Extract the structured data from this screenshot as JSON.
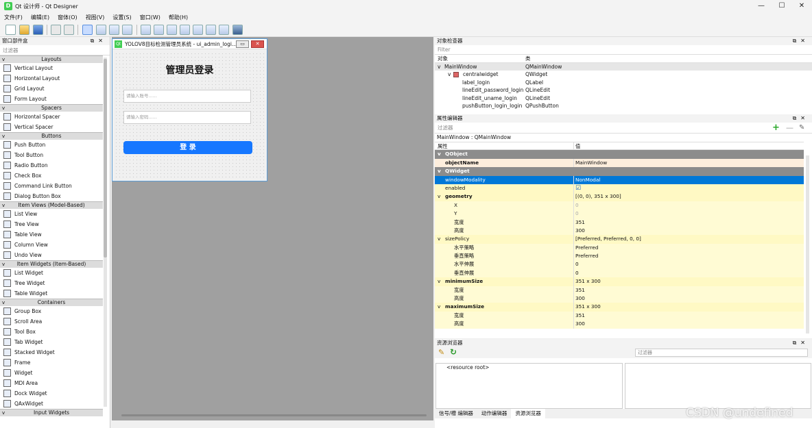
{
  "window": {
    "title": "Qt 设计师 - Qt Designer",
    "app_icon": "D",
    "minimize": "—",
    "maximize": "☐",
    "close": "✕"
  },
  "menu": [
    "文件(F)",
    "编辑(E)",
    "窗体(O)",
    "视图(V)",
    "设置(S)",
    "窗口(W)",
    "帮助(H)"
  ],
  "widget_box": {
    "title": "窗口部件盒",
    "filter_placeholder": "过滤器",
    "categories": [
      {
        "name": "Layouts",
        "items": [
          "Vertical Layout",
          "Horizontal Layout",
          "Grid Layout",
          "Form Layout"
        ]
      },
      {
        "name": "Spacers",
        "items": [
          "Horizontal Spacer",
          "Vertical Spacer"
        ]
      },
      {
        "name": "Buttons",
        "items": [
          "Push Button",
          "Tool Button",
          "Radio Button",
          "Check Box",
          "Command Link Button",
          "Dialog Button Box"
        ]
      },
      {
        "name": "Item Views (Model-Based)",
        "items": [
          "List View",
          "Tree View",
          "Table View",
          "Column View",
          "Undo View"
        ]
      },
      {
        "name": "Item Widgets (Item-Based)",
        "items": [
          "List Widget",
          "Tree Widget",
          "Table Widget"
        ]
      },
      {
        "name": "Containers",
        "items": [
          "Group Box",
          "Scroll Area",
          "Tool Box",
          "Tab Widget",
          "Stacked Widget",
          "Frame",
          "Widget",
          "MDI Area",
          "Dock Widget",
          "QAxWidget"
        ]
      },
      {
        "name": "Input Widgets",
        "items": []
      }
    ]
  },
  "form": {
    "window_title": "YOLOV8目标检测管理员系统 - ui_admin_logi...",
    "heading": "管理员登录",
    "username_placeholder": "请输入账号......",
    "password_placeholder": "请输入密码......",
    "login_button": "登 录"
  },
  "object_inspector": {
    "title": "对象检查器",
    "filter_placeholder": "Filter",
    "col_object": "对象",
    "col_class": "类",
    "rows": [
      {
        "name": "MainWindow",
        "class": "QMainWindow",
        "level": 0,
        "arrow": "v"
      },
      {
        "name": "centralwidget",
        "class": "QWidget",
        "level": 1,
        "arrow": "v"
      },
      {
        "name": "label_login",
        "class": "QLabel",
        "level": 2,
        "arrow": ""
      },
      {
        "name": "lineEdit_password_login",
        "class": "QLineEdit",
        "level": 2,
        "arrow": ""
      },
      {
        "name": "lineEdit_uname_login",
        "class": "QLineEdit",
        "level": 2,
        "arrow": ""
      },
      {
        "name": "pushButton_login_login",
        "class": "QPushButton",
        "level": 2,
        "arrow": ""
      }
    ]
  },
  "property_editor": {
    "title": "属性编辑器",
    "filter_placeholder": "过滤器",
    "context": "MainWindow : QMainWindow",
    "col_property": "属性",
    "col_value": "值",
    "rows": [
      {
        "k": "QObject",
        "v": "",
        "type": "grp"
      },
      {
        "k": "objectName",
        "v": "MainWindow",
        "type": "pk1",
        "bold": true
      },
      {
        "k": "QWidget",
        "v": "",
        "type": "grp"
      },
      {
        "k": "windowModality",
        "v": "NonModal",
        "type": "sel"
      },
      {
        "k": "enabled",
        "v": "☑",
        "type": "y1"
      },
      {
        "k": "geometry",
        "v": "[(0, 0), 351 x 300]",
        "type": "y1",
        "bold": true,
        "arrow": "v"
      },
      {
        "k": "X",
        "v": "0",
        "type": "y2",
        "sub": true,
        "dim": true
      },
      {
        "k": "Y",
        "v": "0",
        "type": "y2",
        "sub": true,
        "dim": true
      },
      {
        "k": "宽度",
        "v": "351",
        "type": "y2",
        "sub": true
      },
      {
        "k": "高度",
        "v": "300",
        "type": "y2",
        "sub": true
      },
      {
        "k": "sizePolicy",
        "v": "[Preferred, Preferred, 0, 0]",
        "type": "y1",
        "arrow": "v"
      },
      {
        "k": "水平策略",
        "v": "Preferred",
        "type": "y2",
        "sub": true
      },
      {
        "k": "垂直策略",
        "v": "Preferred",
        "type": "y2",
        "sub": true
      },
      {
        "k": "水平伸展",
        "v": "0",
        "type": "y2",
        "sub": true
      },
      {
        "k": "垂直伸展",
        "v": "0",
        "type": "y2",
        "sub": true
      },
      {
        "k": "minimumSize",
        "v": "351 x 300",
        "type": "y1",
        "bold": true,
        "arrow": "v"
      },
      {
        "k": "宽度",
        "v": "351",
        "type": "y2",
        "sub": true
      },
      {
        "k": "高度",
        "v": "300",
        "type": "y2",
        "sub": true
      },
      {
        "k": "maximumSize",
        "v": "351 x 300",
        "type": "y1",
        "bold": true,
        "arrow": "v"
      },
      {
        "k": "宽度",
        "v": "351",
        "type": "y2",
        "sub": true
      },
      {
        "k": "高度",
        "v": "300",
        "type": "y2",
        "sub": true
      }
    ]
  },
  "resource_browser": {
    "title": "资源浏览器",
    "filter_placeholder": "过滤器",
    "root": "<resource root>"
  },
  "bottom_tabs": [
    "信号/槽 编辑器",
    "动作编辑器",
    "资源浏览器"
  ],
  "watermark": "CSDN @undefined"
}
